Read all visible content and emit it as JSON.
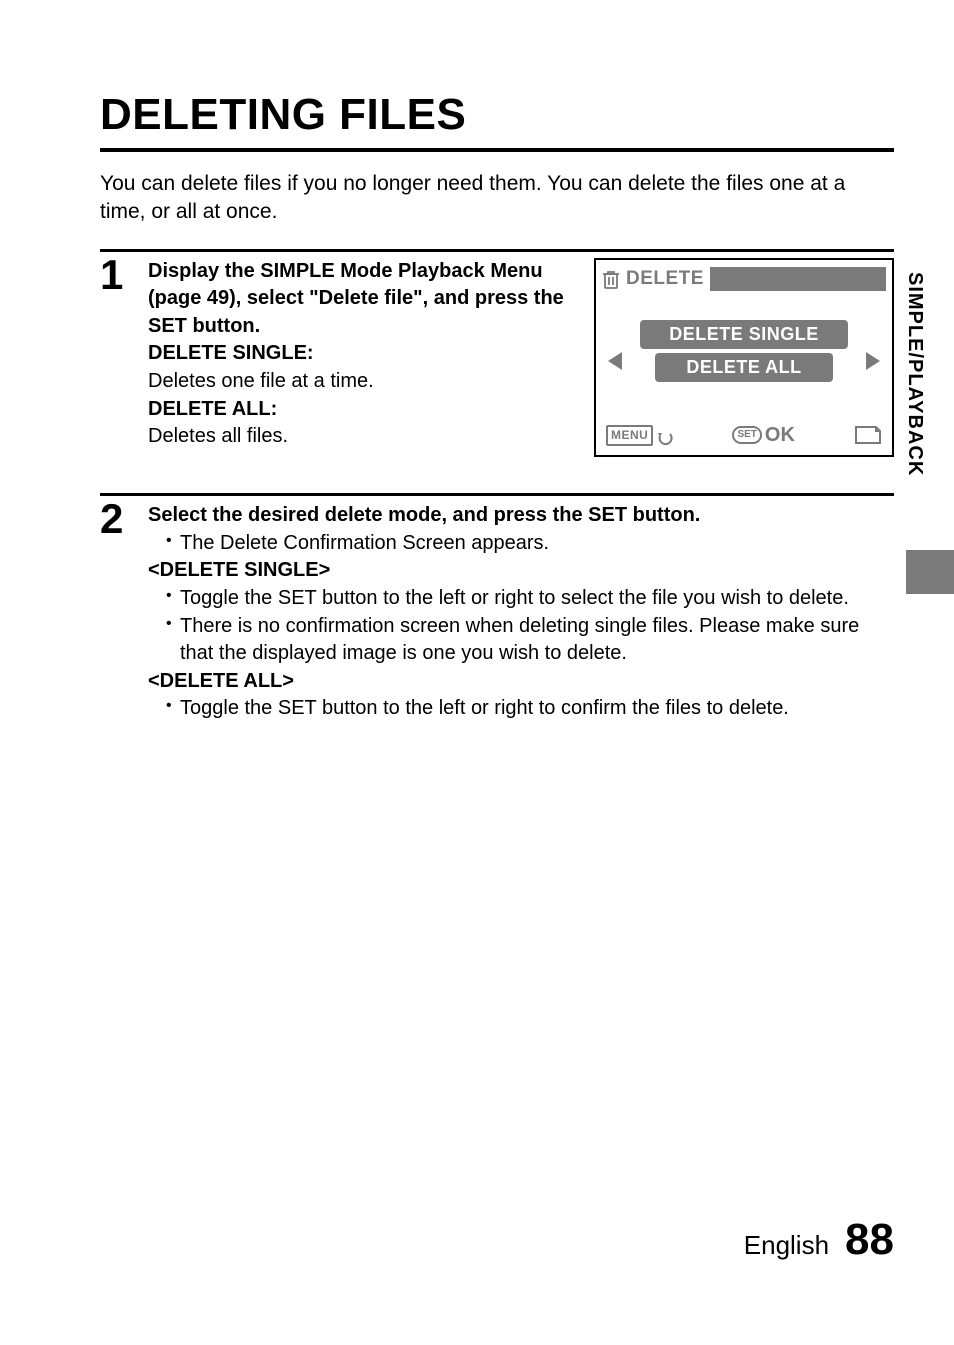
{
  "title": "DELETING FILES",
  "intro": "You can delete files if you no longer need them. You can delete the files one at a time, or all at once.",
  "steps": {
    "s1": {
      "num": "1",
      "instruction": "Display the SIMPLE Mode Playback Menu (page 49), select \"Delete file\", and press the SET button.",
      "ds_label": "DELETE SINGLE:",
      "ds_desc": "Deletes one file at a time.",
      "da_label": "DELETE ALL:",
      "da_desc": "Deletes all files."
    },
    "s2": {
      "num": "2",
      "instruction": "Select the desired delete mode, and press the SET button.",
      "bullet1": "The Delete Confirmation Screen appears.",
      "ds_heading": "<DELETE SINGLE>",
      "ds_b1": "Toggle the SET button to the left or right to select the file you wish to delete.",
      "ds_b2": "There is no confirmation screen when deleting single files. Please make sure that the displayed image is one you wish to delete.",
      "da_heading": "<DELETE ALL>",
      "da_b1": "Toggle the SET button to the left or right to confirm the files to delete."
    }
  },
  "screen": {
    "title": "DELETE",
    "option1": "DELETE SINGLE",
    "option2": "DELETE ALL",
    "menu": "MENU",
    "set": "SET",
    "ok": "OK"
  },
  "sideTab": "SIMPLE/PLAYBACK",
  "footer": {
    "lang": "English",
    "page": "88"
  }
}
